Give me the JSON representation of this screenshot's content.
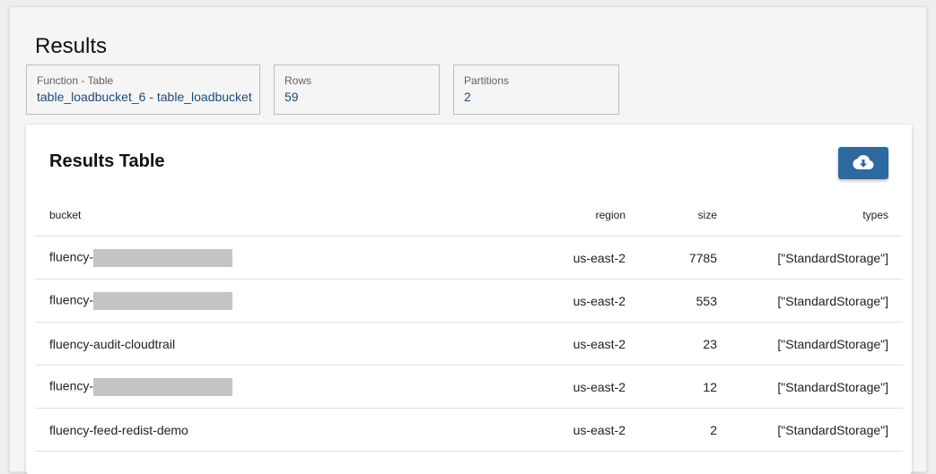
{
  "page": {
    "title": "Results"
  },
  "stats": [
    {
      "label": "Function - Table",
      "value": "table_loadbucket_6 - table_loadbucket"
    },
    {
      "label": "Rows",
      "value": "59"
    },
    {
      "label": "Partitions",
      "value": "2"
    }
  ],
  "table": {
    "title": "Results Table",
    "download_icon": "cloud-download-icon",
    "columns": [
      "bucket",
      "region",
      "size",
      "types"
    ],
    "rows": [
      {
        "bucket": "fluency-",
        "redacted": true,
        "region": "us-east-2",
        "size": "7785",
        "types": "[\"StandardStorage\"]"
      },
      {
        "bucket": "fluency-",
        "redacted": true,
        "region": "us-east-2",
        "size": "553",
        "types": "[\"StandardStorage\"]"
      },
      {
        "bucket": "fluency-audit-cloudtrail",
        "redacted": false,
        "region": "us-east-2",
        "size": "23",
        "types": "[\"StandardStorage\"]"
      },
      {
        "bucket": "fluency-",
        "redacted": true,
        "region": "us-east-2",
        "size": "12",
        "types": "[\"StandardStorage\"]"
      },
      {
        "bucket": "fluency-feed-redist-demo",
        "redacted": false,
        "region": "us-east-2",
        "size": "2",
        "types": "[\"StandardStorage\"]"
      }
    ]
  }
}
